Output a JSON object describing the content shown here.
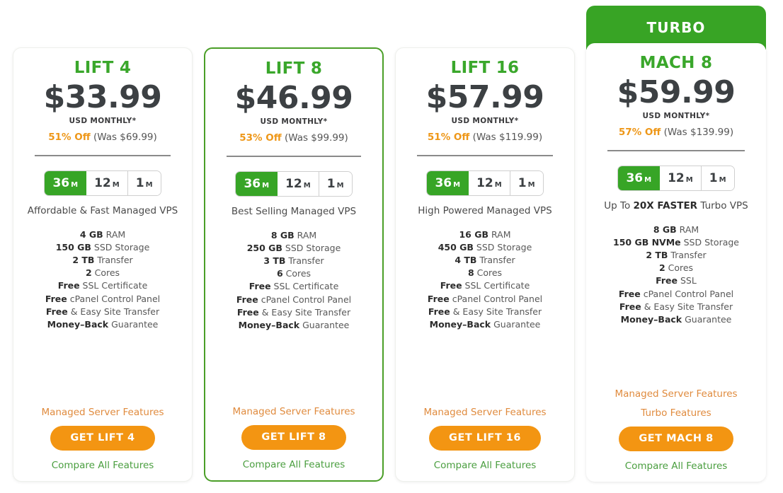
{
  "colors": {
    "brand_green": "#38a425",
    "plan_name_green": "#3aa72b",
    "cta_orange": "#f39512",
    "discount_orange": "#ee9718",
    "feature_link_orange": "#e08b3e",
    "compare_link_green": "#4a9e3f",
    "featured_border": "#4a9e27"
  },
  "plans": [
    {
      "ribbon": null,
      "name": "LIFT 4",
      "price": "$33.99",
      "price_unit": "USD MONTHLY*",
      "discount_percent": "51% Off",
      "was_price": "(Was $69.99)",
      "terms": [
        {
          "num": "36",
          "unit": "M",
          "active": true
        },
        {
          "num": "12",
          "unit": "M",
          "active": false
        },
        {
          "num": "1",
          "unit": "M",
          "active": false
        }
      ],
      "tagline_html": "Affordable &amp; Fast Managed VPS",
      "specs": [
        {
          "strong": "4 GB",
          "rest": " RAM"
        },
        {
          "strong": "150 GB",
          "rest": " SSD Storage"
        },
        {
          "strong": "2 TB",
          "rest": " Transfer"
        },
        {
          "strong": "2",
          "rest": " Cores"
        },
        {
          "strong": "Free",
          "rest": " SSL Certificate"
        },
        {
          "strong": "Free",
          "rest": " cPanel Control Panel"
        },
        {
          "strong": "Free",
          "rest": " & Easy Site Transfer"
        },
        {
          "strong": "Money–Back",
          "rest": " Guarantee"
        }
      ],
      "feature_links": [
        "Managed Server Features"
      ],
      "cta_label": "GET LIFT 4",
      "compare_label": "Compare All Features"
    },
    {
      "ribbon": null,
      "name": "LIFT 8",
      "price": "$46.99",
      "price_unit": "USD MONTHLY*",
      "discount_percent": "53% Off",
      "was_price": "(Was $99.99)",
      "terms": [
        {
          "num": "36",
          "unit": "M",
          "active": true
        },
        {
          "num": "12",
          "unit": "M",
          "active": false
        },
        {
          "num": "1",
          "unit": "M",
          "active": false
        }
      ],
      "tagline_html": "Best Selling Managed VPS",
      "specs": [
        {
          "strong": "8 GB",
          "rest": " RAM"
        },
        {
          "strong": "250 GB",
          "rest": " SSD Storage"
        },
        {
          "strong": "3 TB",
          "rest": " Transfer"
        },
        {
          "strong": "6",
          "rest": " Cores"
        },
        {
          "strong": "Free",
          "rest": " SSL Certificate"
        },
        {
          "strong": "Free",
          "rest": " cPanel Control Panel"
        },
        {
          "strong": "Free",
          "rest": " & Easy Site Transfer"
        },
        {
          "strong": "Money–Back",
          "rest": " Guarantee"
        }
      ],
      "feature_links": [
        "Managed Server Features"
      ],
      "cta_label": "GET LIFT 8",
      "compare_label": "Compare All Features"
    },
    {
      "ribbon": null,
      "name": "LIFT 16",
      "price": "$57.99",
      "price_unit": "USD MONTHLY*",
      "discount_percent": "51% Off",
      "was_price": "(Was $119.99)",
      "terms": [
        {
          "num": "36",
          "unit": "M",
          "active": true
        },
        {
          "num": "12",
          "unit": "M",
          "active": false
        },
        {
          "num": "1",
          "unit": "M",
          "active": false
        }
      ],
      "tagline_html": "High Powered Managed VPS",
      "specs": [
        {
          "strong": "16 GB",
          "rest": " RAM"
        },
        {
          "strong": "450 GB",
          "rest": " SSD Storage"
        },
        {
          "strong": "4 TB",
          "rest": " Transfer"
        },
        {
          "strong": "8",
          "rest": " Cores"
        },
        {
          "strong": "Free",
          "rest": " SSL Certificate"
        },
        {
          "strong": "Free",
          "rest": " cPanel Control Panel"
        },
        {
          "strong": "Free",
          "rest": " & Easy Site Transfer"
        },
        {
          "strong": "Money–Back",
          "rest": " Guarantee"
        }
      ],
      "feature_links": [
        "Managed Server Features"
      ],
      "cta_label": "GET LIFT 16",
      "compare_label": "Compare All Features"
    },
    {
      "ribbon": "TURBO",
      "name": "MACH 8",
      "price": "$59.99",
      "price_unit": "USD MONTHLY*",
      "discount_percent": "57% Off",
      "was_price": "(Was $139.99)",
      "terms": [
        {
          "num": "36",
          "unit": "M",
          "active": true
        },
        {
          "num": "12",
          "unit": "M",
          "active": false
        },
        {
          "num": "1",
          "unit": "M",
          "active": false
        }
      ],
      "tagline_html": "Up To <b>20X FASTER</b> Turbo VPS",
      "specs": [
        {
          "strong": "8 GB",
          "rest": " RAM"
        },
        {
          "strong": "150 GB NVMe",
          "rest": " SSD Storage"
        },
        {
          "strong": "2 TB",
          "rest": " Transfer"
        },
        {
          "strong": "2",
          "rest": " Cores"
        },
        {
          "strong": "Free",
          "rest": " SSL"
        },
        {
          "strong": "Free",
          "rest": " cPanel Control Panel"
        },
        {
          "strong": "Free",
          "rest": " & Easy Site Transfer"
        },
        {
          "strong": "Money–Back",
          "rest": " Guarantee"
        }
      ],
      "feature_links": [
        "Managed Server Features",
        "Turbo Features"
      ],
      "cta_label": "GET MACH 8",
      "compare_label": "Compare All Features"
    }
  ]
}
